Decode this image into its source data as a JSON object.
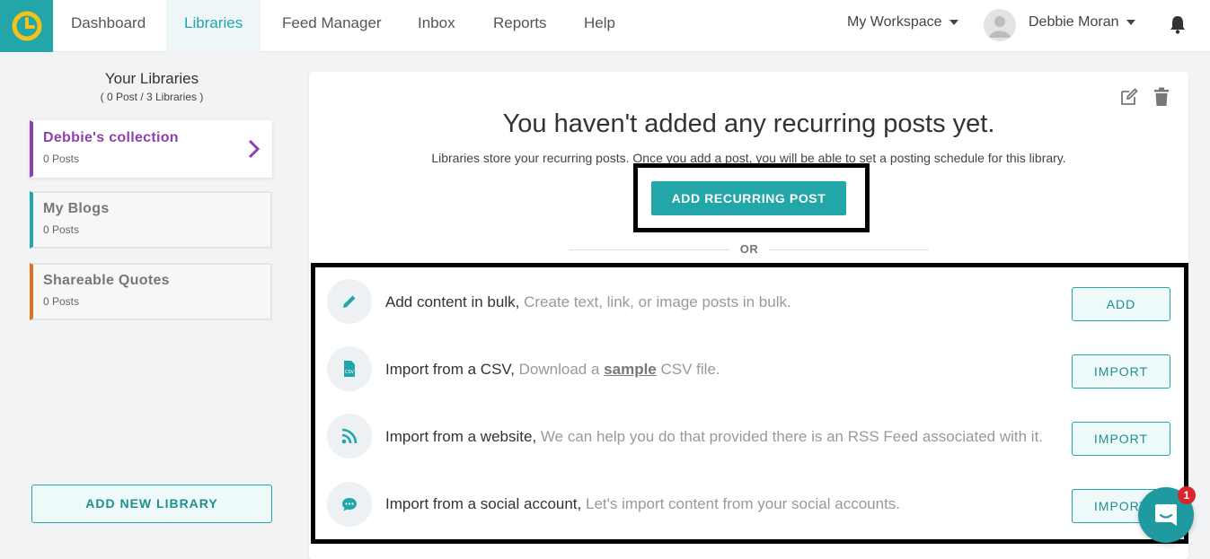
{
  "nav": {
    "items": [
      "Dashboard",
      "Libraries",
      "Feed Manager",
      "Inbox",
      "Reports",
      "Help"
    ],
    "active": "Libraries",
    "workspace": "My Workspace",
    "user_name": "Debbie Moran"
  },
  "sidebar": {
    "title": "Your Libraries",
    "subtitle": "( 0 Post / 3 Libraries )",
    "libraries": [
      {
        "name": "Debbie's collection",
        "count": "0 Posts",
        "color": "#8e3fb0"
      },
      {
        "name": "My Blogs",
        "count": "0 Posts",
        "color": "#22a6a8"
      },
      {
        "name": "Shareable Quotes",
        "count": "0 Posts",
        "color": "#e0701f"
      }
    ],
    "add_button": "ADD NEW LIBRARY"
  },
  "main": {
    "headline": "You haven't added any recurring posts yet.",
    "subline": "Libraries store your recurring posts. Once you add a post, you will be able to set a posting schedule for this library.",
    "primary_button": "ADD RECURRING POST",
    "or_label": "OR",
    "options": [
      {
        "icon": "pencil-icon",
        "title": "Add content in bulk,",
        "desc": "Create text, link, or image posts in bulk.",
        "button": "ADD"
      },
      {
        "icon": "csv-file-icon",
        "title": "Import from a CSV,",
        "desc_pre": "Download a",
        "link": "sample",
        "desc_post": "CSV file.",
        "button": "IMPORT"
      },
      {
        "icon": "rss-icon",
        "title": "Import from a website,",
        "desc": "We can help you do that provided there is an RSS Feed associated with it.",
        "button": "IMPORT"
      },
      {
        "icon": "chat-bubble-icon",
        "title": "Import from a social account,",
        "desc": "Let's import content from your social accounts.",
        "button": "IMPORT"
      }
    ]
  },
  "chat": {
    "badge": "1"
  },
  "colors": {
    "accent": "#22a6a8",
    "badge": "#d9262c"
  }
}
